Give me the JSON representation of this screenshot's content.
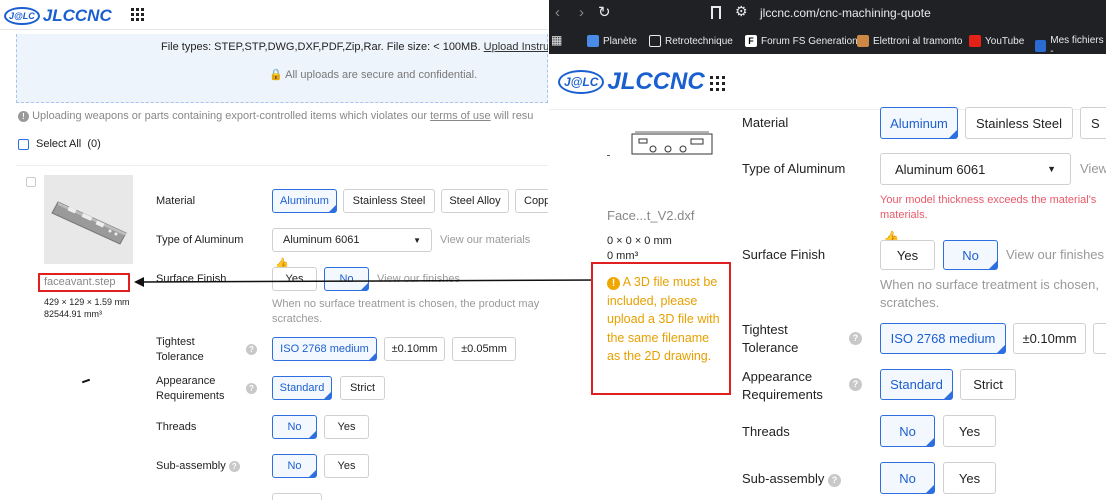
{
  "left": {
    "logo_mark": "J@LC",
    "logo_text": "JLCCNC",
    "file_types": "File types: STEP,STP,DWG,DXF,PDF,Zip,Rar. File size: < 100MB.",
    "upload_link": "Upload Instructi",
    "secure_note": "All uploads are secure and confidential.",
    "warning_prefix": "Uploading weapons or parts containing export-controlled items which violates our ",
    "warning_link": "terms of use",
    "warning_suffix": " will resu",
    "select_all": "Select All",
    "select_count": "(0)",
    "file_name": "faceavant.step",
    "dims": "429 × 129 × 1.59 mm",
    "volume": "82544.91 mm³",
    "material_label": "Material",
    "materials": [
      "Aluminum",
      "Stainless Steel",
      "Steel Alloy",
      "Copp"
    ],
    "type_label": "Type of Aluminum",
    "type_value": "Aluminum 6061",
    "view_materials": "View our materials",
    "finish_label": "Surface Finish",
    "finish_yes": "Yes",
    "finish_no": "No",
    "view_finishes": "View our finishes",
    "finish_note": "When no surface treatment is chosen, the product may scratches.",
    "tolerance_label": "Tightest Tolerance",
    "tolerances": [
      "ISO 2768 medium",
      "±0.10mm",
      "±0.05mm"
    ],
    "appearance_label": "Appearance Requirements",
    "appearance": [
      "Standard",
      "Strict"
    ],
    "threads_label": "Threads",
    "threads": [
      "No",
      "Yes"
    ],
    "subassembly_label": "Sub-assembly",
    "subassembly": [
      "No",
      "Yes"
    ]
  },
  "right": {
    "url": "jlccnc.com/cnc-machining-quote",
    "bookmarks": [
      "Planète",
      "Retrotechnique",
      "Forum FS Generation",
      "Elettroni al tramonto",
      "YouTube",
      "Mes fichiers -"
    ],
    "logo_mark": "J@LC",
    "logo_text": "JLCCNC",
    "file_name": "Face...t_V2.dxf",
    "dims": "0 × 0 × 0 mm",
    "volume": "0 mm³",
    "material_label": "Material",
    "materials": [
      "Aluminum",
      "Stainless Steel",
      "S"
    ],
    "type_label": "Type of Aluminum",
    "type_value": "Aluminum 6061",
    "view_short": "View",
    "thickness_warning": "Your model thickness exceeds the material's materials.",
    "finish_label": "Surface Finish",
    "finish_yes": "Yes",
    "finish_no": "No",
    "view_finishes": "View our finishes",
    "finish_note": "When no surface treatment is chosen, scratches.",
    "tolerance_label": "Tightest Tolerance",
    "tolerances": [
      "ISO 2768 medium",
      "±0.10mm"
    ],
    "appearance_label": "Appearance Requirements",
    "appearance": [
      "Standard",
      "Strict"
    ],
    "threads_label": "Threads",
    "threads": [
      "No",
      "Yes"
    ],
    "subassembly_label": "Sub-assembly",
    "subassembly": [
      "No",
      "Yes"
    ],
    "alert": "A 3D file must be included, please upload a 3D file with the same filename as the 2D drawing."
  },
  "colors": {
    "brand": "#1a5fd0",
    "selected": "#2d6ee0",
    "alert_border": "#e02020",
    "alert_text": "#e8a000",
    "warning_red": "#e85a6a",
    "chrome": "#202124"
  }
}
